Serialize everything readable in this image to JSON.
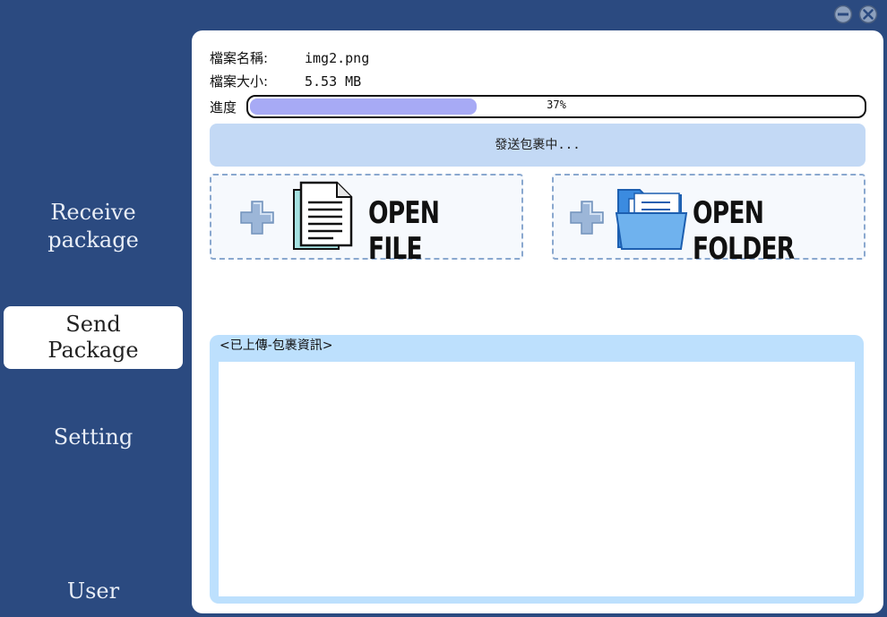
{
  "window": {
    "minimize_icon": "minimize-icon",
    "close_icon": "close-icon"
  },
  "sidebar": {
    "items": [
      {
        "line1": "Receive",
        "line2": "package",
        "active": false
      },
      {
        "line1": "Send",
        "line2": "Package",
        "active": true
      },
      {
        "line1": "Setting",
        "line2": "",
        "active": false
      },
      {
        "line1": "User",
        "line2": "",
        "active": false
      }
    ]
  },
  "file_info": {
    "name_label": "檔案名稱:",
    "name_value": "img2.png",
    "size_label": "檔案大小:",
    "size_value": "5.53 MB",
    "progress_label": "進度"
  },
  "progress": {
    "percent": 37,
    "text": "37%"
  },
  "status": "發送包裹中...",
  "actions": {
    "open_file": "OPEN FILE",
    "open_folder": "OPEN FOLDER",
    "file_icon": "document-icon",
    "folder_icon": "folder-icon",
    "plus_icon": "plus-icon"
  },
  "uploaded": {
    "title": "<已上傳-包裹資訊>",
    "items": []
  },
  "colors": {
    "background": "#2b4a80",
    "panel": "#ffffff",
    "progress_fill": "#a7aaf5",
    "status_bar": "#c3d9f5",
    "uploaded_frame": "#bde0fd"
  }
}
